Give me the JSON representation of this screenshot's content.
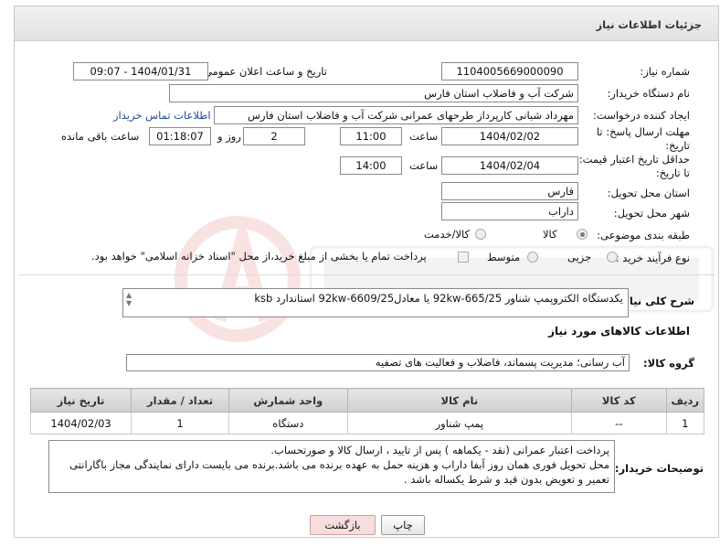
{
  "page_title": "جزئیات اطلاعات نیاز",
  "fields": {
    "need_number_label": "شماره نیاز:",
    "need_number": "1104005669000090",
    "announce_label": "تاریخ و ساعت اعلان عمومی:",
    "announce_value": "1404/01/31 - 09:07",
    "buyer_org_label": "نام دستگاه خریدار:",
    "buyer_org": "شرکت آب و فاضلاب استان فارس",
    "creator_label": "ایجاد کننده درخواست:",
    "creator": "مهرداد شبانی کارپرداز طرحهای عمرانی  شرکت آب و فاضلاب استان فارس",
    "contact_link": "اطلاعات تماس خریدار",
    "deadline_label_1": "مهلت ارسال پاسخ: تا",
    "deadline_label_2": "تاریخ:",
    "deadline_date": "1404/02/02",
    "time_label": "ساعت",
    "deadline_time": "11:00",
    "days_count": "2",
    "days_label": "روز و",
    "remaining_time": "01:18:07",
    "remaining_label": "ساعت باقی مانده",
    "price_valid_label_1": "حداقل تاریخ اعتبار قیمت:",
    "price_valid_label_2": "تا تاریخ:",
    "price_valid_date": "1404/02/04",
    "price_valid_time": "14:00",
    "province_label": "استان محل تحویل:",
    "province": "فارس",
    "city_label": "شهر محل تحویل:",
    "city": "داراب",
    "category_label": "طبقه بندی موضوعی:",
    "category_options": [
      "کالا",
      "کالا/خدمت"
    ],
    "process_label": "نوع فرآیند خرید :",
    "process_options": [
      "جزیی",
      "متوسط"
    ],
    "payment_note": "پرداخت تمام یا بخشی از مبلغ خرید،از محل \"اسناد خزانه اسلامی\" خواهد بود."
  },
  "general_desc_label": "شرح کلی نیاز:",
  "general_desc": "یکدستگاه الکتروپمپ شناور  92kw-665/25  یا  معادل92kw-6609/25      استاندارد ksb",
  "goods_info_title": "اطلاعات کالاهای مورد نیاز",
  "goods_group_label": "گروه کالا:",
  "goods_group": "آب رسانی؛ مدیریت پسماند، فاضلاب و فعالیت های تصفیه",
  "table": {
    "headers": [
      "ردیف",
      "کد کالا",
      "نام کالا",
      "واحد شمارش",
      "تعداد / مقدار",
      "تاریخ نیاز"
    ],
    "rows": [
      [
        "1",
        "--",
        "پمپ شناور",
        "دستگاه",
        "1",
        "1404/02/03"
      ]
    ]
  },
  "buyer_notes_label": "توضیحات خریدار:",
  "buyer_notes": [
    "پرداخت اعتبار  عمرانی  (نقد - یکماهه ) پس از تایید ، ارسال کالا  و صورتحساب.",
    "محل تحویل فوری همان روز آبفا داراب  و هزینه حمل به عهده برنده می باشد.برنده می بایست دارای نمایندگی مجاز باگارانتی",
    "تعمیر و تعویض بدون قید و شرط یکساله باشد ."
  ],
  "buttons": {
    "print": "چاپ",
    "back": "بازگشت"
  },
  "colors": {
    "link": "#1a4c99",
    "back_button": "#f7dede",
    "header_bg": "#e2e2e2"
  }
}
